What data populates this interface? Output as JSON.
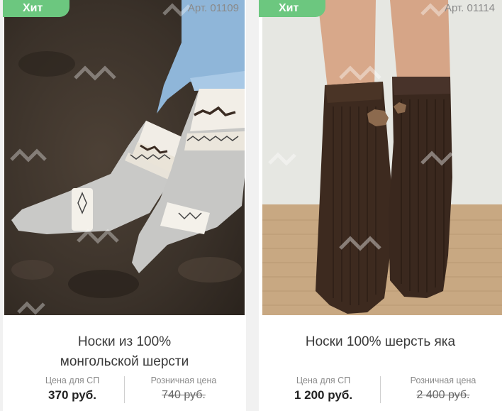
{
  "products": [
    {
      "badge": "Хит",
      "article": "Арт. 01109",
      "title_line1": "Носки из 100%",
      "title_line2": "монгольской шерсти",
      "sp_price_label": "Цена для СП",
      "sp_price": "370 руб.",
      "retail_price_label": "Розничная цена",
      "retail_price": "740 руб."
    },
    {
      "badge": "Хит",
      "article": "Арт. 01114",
      "title_line1": "Носки 100% шерсть яка",
      "sp_price_label": "Цена для СП",
      "sp_price": "1 200 руб.",
      "retail_price_label": "Розничная цена",
      "retail_price": "2 400 руб."
    }
  ],
  "colors": {
    "badge_bg": "#6cc77f",
    "page_bg": "#f1f1f1"
  }
}
